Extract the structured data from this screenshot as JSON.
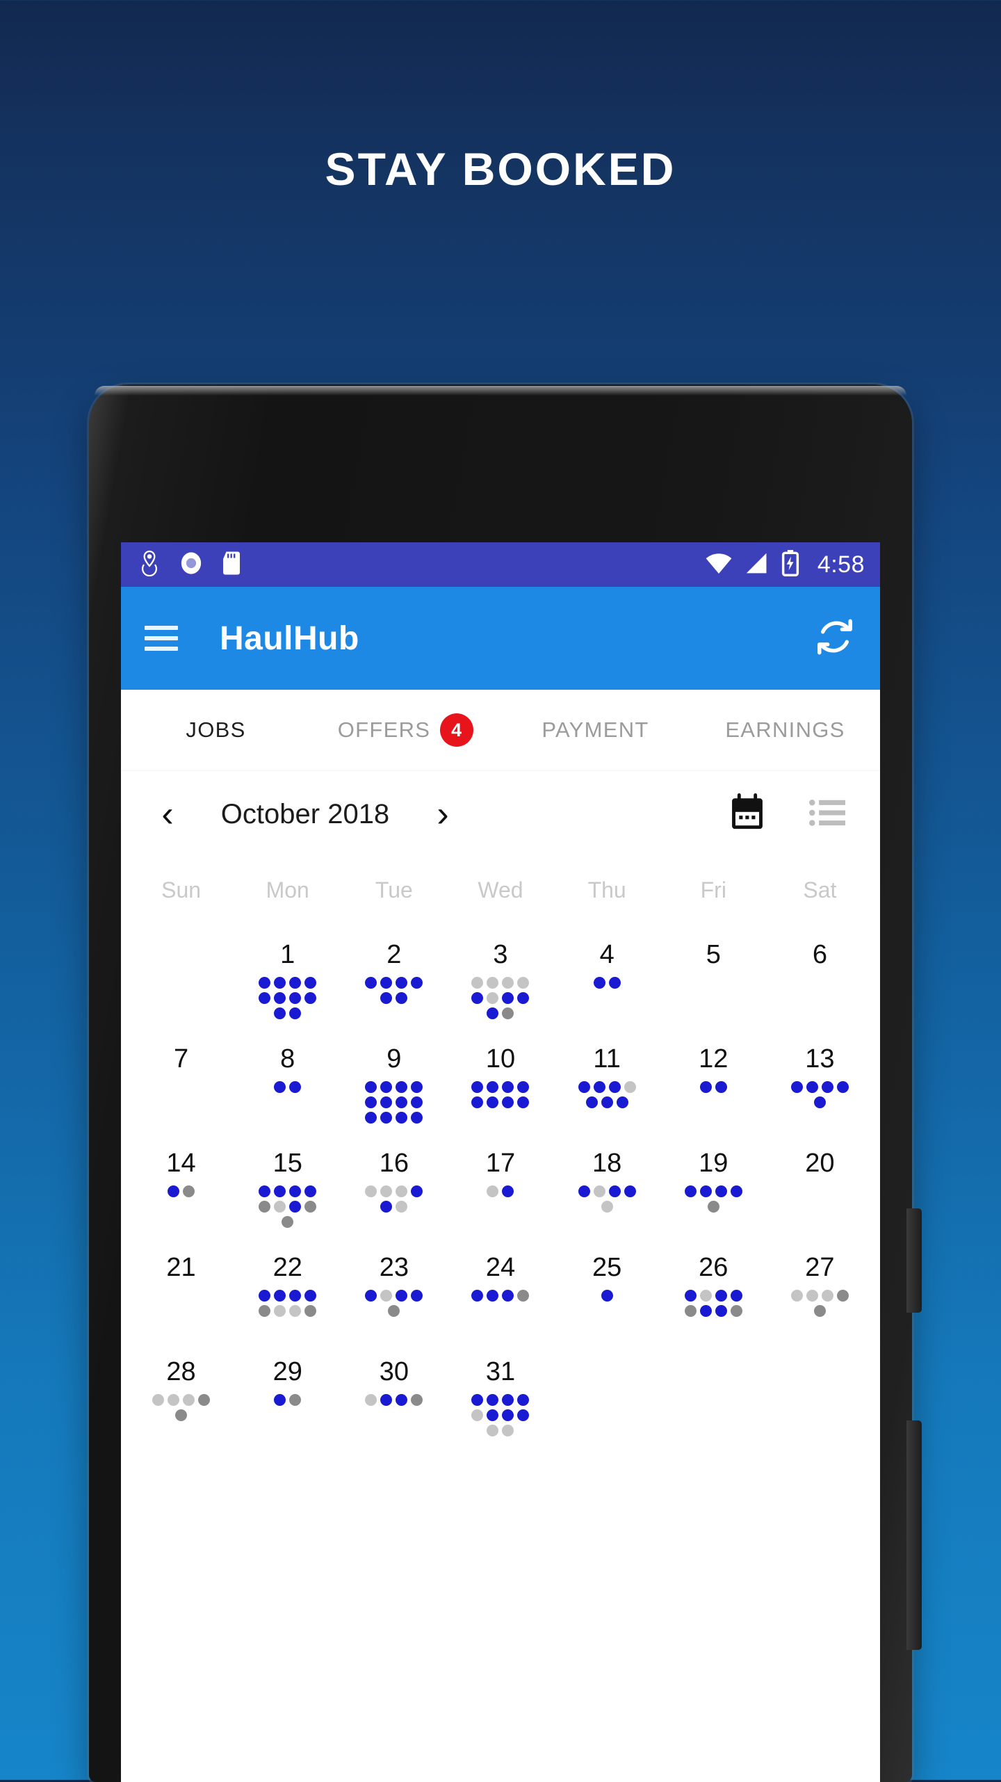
{
  "headline": "STAY BOOKED",
  "colors": {
    "bg_top": "#12294f",
    "bg_bottom": "#1685c9",
    "statusbar": "#3c41b9",
    "appbar": "#1e88e5",
    "badge": "#e8141b",
    "dot_blue": "#1a1ad2",
    "dot_light_gray": "#c4c4c4",
    "dot_dark_gray": "#8a8a8a"
  },
  "statusbar": {
    "time": "4:58",
    "left_icons": [
      "location-icon",
      "record-icon",
      "sd-card-icon"
    ],
    "right_icons": [
      "wifi-icon",
      "cell-signal-icon",
      "battery-charging-icon"
    ]
  },
  "appbar": {
    "menu_icon": "hamburger-menu-icon",
    "title": "HaulHub",
    "action_icon": "sync-refresh-icon"
  },
  "tabs": [
    {
      "label": "JOBS",
      "active": true,
      "badge": null
    },
    {
      "label": "OFFERS",
      "active": false,
      "badge": "4"
    },
    {
      "label": "PAYMENT",
      "active": false,
      "badge": null
    },
    {
      "label": "EARNINGS",
      "active": false,
      "badge": null
    }
  ],
  "calendar": {
    "prev_label": "‹",
    "next_label": "›",
    "month_label": "October 2018",
    "view_icons": [
      {
        "name": "calendar-view-icon",
        "active": true
      },
      {
        "name": "list-view-icon",
        "active": false
      }
    ],
    "weekdays": [
      "Sun",
      "Mon",
      "Tue",
      "Wed",
      "Thu",
      "Fri",
      "Sat"
    ],
    "weeks": [
      [
        {
          "day": "",
          "dots": []
        },
        {
          "day": "1",
          "dots": [
            [
              "b",
              "b",
              "b",
              "b"
            ],
            [
              "b",
              "b",
              "b",
              "b"
            ],
            [
              "b",
              "b"
            ]
          ]
        },
        {
          "day": "2",
          "dots": [
            [
              "b",
              "b",
              "b",
              "b"
            ],
            [
              "b",
              "b"
            ]
          ]
        },
        {
          "day": "3",
          "dots": [
            [
              "l",
              "l",
              "l",
              "l"
            ],
            [
              "b",
              "l",
              "b",
              "b"
            ],
            [
              "b",
              "d"
            ]
          ]
        },
        {
          "day": "4",
          "dots": [
            [
              "b",
              "b"
            ]
          ]
        },
        {
          "day": "5",
          "dots": []
        },
        {
          "day": "6",
          "dots": []
        }
      ],
      [
        {
          "day": "7",
          "dots": []
        },
        {
          "day": "8",
          "dots": [
            [
              "b",
              "b"
            ]
          ]
        },
        {
          "day": "9",
          "dots": [
            [
              "b",
              "b",
              "b",
              "b"
            ],
            [
              "b",
              "b",
              "b",
              "b"
            ],
            [
              "b",
              "b",
              "b",
              "b"
            ]
          ]
        },
        {
          "day": "10",
          "dots": [
            [
              "b",
              "b",
              "b",
              "b"
            ],
            [
              "b",
              "b",
              "b",
              "b"
            ]
          ]
        },
        {
          "day": "11",
          "dots": [
            [
              "b",
              "b",
              "b",
              "l"
            ],
            [
              "b",
              "b",
              "b"
            ]
          ]
        },
        {
          "day": "12",
          "dots": [
            [
              "b",
              "b"
            ]
          ]
        },
        {
          "day": "13",
          "dots": [
            [
              "b",
              "b",
              "b",
              "b"
            ],
            [
              "b"
            ]
          ]
        }
      ],
      [
        {
          "day": "14",
          "dots": [
            [
              "b",
              "d"
            ]
          ]
        },
        {
          "day": "15",
          "dots": [
            [
              "b",
              "b",
              "b",
              "b"
            ],
            [
              "d",
              "l",
              "b",
              "d"
            ],
            [
              "d"
            ]
          ]
        },
        {
          "day": "16",
          "dots": [
            [
              "l",
              "l",
              "l",
              "b"
            ],
            [
              "b",
              "l"
            ]
          ]
        },
        {
          "day": "17",
          "dots": [
            [
              "l",
              "b"
            ]
          ]
        },
        {
          "day": "18",
          "dots": [
            [
              "b",
              "l",
              "b",
              "b"
            ],
            [
              "l"
            ]
          ]
        },
        {
          "day": "19",
          "dots": [
            [
              "b",
              "b",
              "b",
              "b"
            ],
            [
              "d"
            ]
          ]
        },
        {
          "day": "20",
          "dots": []
        }
      ],
      [
        {
          "day": "21",
          "dots": []
        },
        {
          "day": "22",
          "dots": [
            [
              "b",
              "b",
              "b",
              "b"
            ],
            [
              "d",
              "l",
              "l",
              "d"
            ]
          ]
        },
        {
          "day": "23",
          "dots": [
            [
              "b",
              "l",
              "b",
              "b"
            ],
            [
              "d"
            ]
          ]
        },
        {
          "day": "24",
          "dots": [
            [
              "b",
              "b",
              "b",
              "d"
            ]
          ]
        },
        {
          "day": "25",
          "dots": [
            [
              "b"
            ]
          ]
        },
        {
          "day": "26",
          "dots": [
            [
              "b",
              "l",
              "b",
              "b"
            ],
            [
              "d",
              "b",
              "b",
              "d"
            ]
          ]
        },
        {
          "day": "27",
          "dots": [
            [
              "l",
              "l",
              "l",
              "d"
            ],
            [
              "d"
            ]
          ]
        }
      ],
      [
        {
          "day": "28",
          "dots": [
            [
              "l",
              "l",
              "l",
              "d"
            ],
            [
              "d"
            ]
          ]
        },
        {
          "day": "29",
          "dots": [
            [
              "b",
              "d"
            ]
          ]
        },
        {
          "day": "30",
          "dots": [
            [
              "l",
              "b",
              "b",
              "d"
            ]
          ]
        },
        {
          "day": "31",
          "dots": [
            [
              "b",
              "b",
              "b",
              "b"
            ],
            [
              "l",
              "b",
              "b",
              "b"
            ],
            [
              "l",
              "l"
            ]
          ]
        },
        {
          "day": "",
          "dots": []
        },
        {
          "day": "",
          "dots": []
        },
        {
          "day": "",
          "dots": []
        }
      ]
    ]
  }
}
